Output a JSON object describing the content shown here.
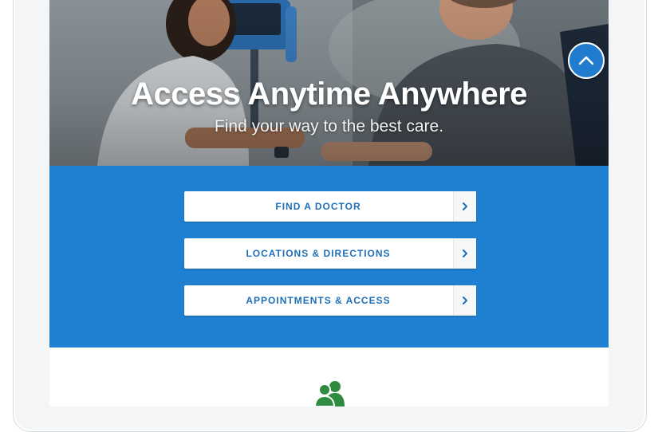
{
  "hero": {
    "title": "Access Anytime Anywhere",
    "subtitle": "Find your way to the best care."
  },
  "scroll_top": {
    "icon": "chevron-up-icon"
  },
  "actions": [
    {
      "label": "FIND A DOCTOR",
      "icon": "chevron-right-icon"
    },
    {
      "label": "LOCATIONS & DIRECTIONS",
      "icon": "chevron-right-icon"
    },
    {
      "label": "APPOINTMENTS & ACCESS",
      "icon": "chevron-right-icon"
    }
  ],
  "lower_section": {
    "icon": "people-icon"
  },
  "colors": {
    "brand_blue": "#1f7fd1",
    "button_text": "#1f6fb8",
    "people_icon": "#2e8b3f"
  }
}
